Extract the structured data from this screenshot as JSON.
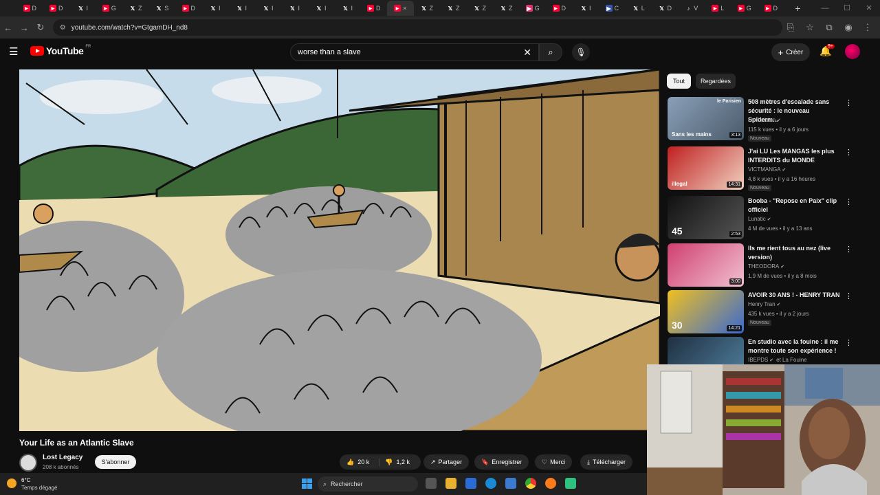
{
  "browser": {
    "tabs": [
      {
        "icon": "youtube-icon",
        "label": "D",
        "color": "#ff0033"
      },
      {
        "icon": "youtube-icon",
        "label": "D",
        "color": "#ff0033"
      },
      {
        "icon": "x-icon",
        "label": "I",
        "color": "#ffffff"
      },
      {
        "icon": "youtube-icon",
        "label": "G",
        "color": "#ff0033"
      },
      {
        "icon": "x-icon",
        "label": "Z",
        "color": "#ffffff"
      },
      {
        "icon": "x-icon",
        "label": "S",
        "color": "#ffffff"
      },
      {
        "icon": "youtube-icon",
        "label": "D",
        "color": "#ff0033"
      },
      {
        "icon": "x-icon",
        "label": "I",
        "color": "#ffffff"
      },
      {
        "icon": "x-icon",
        "label": "I",
        "color": "#ffffff"
      },
      {
        "icon": "x-icon",
        "label": "I",
        "color": "#ffffff"
      },
      {
        "icon": "x-icon",
        "label": "I",
        "color": "#ffffff"
      },
      {
        "icon": "x-icon",
        "label": "I",
        "color": "#ffffff"
      },
      {
        "icon": "x-icon",
        "label": "I",
        "color": "#ffffff"
      },
      {
        "icon": "youtube-icon",
        "label": "D",
        "color": "#ff0033"
      },
      {
        "icon": "youtube-icon",
        "label": "×",
        "color": "#ff0033",
        "active": true
      },
      {
        "icon": "x-icon",
        "label": "Z",
        "color": "#ffffff"
      },
      {
        "icon": "x-icon",
        "label": "Z",
        "color": "#ffffff"
      },
      {
        "icon": "x-icon",
        "label": "Z",
        "color": "#ffffff"
      },
      {
        "icon": "x-icon",
        "label": "Z",
        "color": "#ffffff"
      },
      {
        "icon": "instagram-icon",
        "label": "G",
        "color": "#e1306c"
      },
      {
        "icon": "youtube-icon",
        "label": "D",
        "color": "#ff0033"
      },
      {
        "icon": "x-icon",
        "label": "I",
        "color": "#ffffff"
      },
      {
        "icon": "site-icon",
        "label": "C",
        "color": "#3355aa"
      },
      {
        "icon": "x-icon",
        "label": "L",
        "color": "#ffffff"
      },
      {
        "icon": "x-icon",
        "label": "D",
        "color": "#ffffff"
      },
      {
        "icon": "tiktok-icon",
        "label": "V",
        "color": "#ffffff"
      },
      {
        "icon": "youtube-icon",
        "label": "L",
        "color": "#ff0033"
      },
      {
        "icon": "youtube-icon",
        "label": "G",
        "color": "#ff0033"
      },
      {
        "icon": "youtube-icon",
        "label": "D",
        "color": "#ff0033"
      }
    ],
    "new_tab": "+",
    "url": "youtube.com/watch?v=GtgamDH_nd8"
  },
  "header": {
    "logo_text": "YouTube",
    "logo_country": "FR",
    "search_value": "worse than a slave",
    "create_label": "Créer",
    "notif_count": "9+"
  },
  "video": {
    "title": "Your Life as an Atlantic Slave",
    "channel": "Lost Legacy",
    "subscribers": "208 k abonnés",
    "subscribe_label": "S'abonner",
    "likes": "20 k",
    "dislikes": "1,2 k",
    "share_label": "Partager",
    "save_label": "Enregistrer",
    "thanks_label": "Merci",
    "download_label": "Télécharger"
  },
  "chips": {
    "all": "Tout",
    "watched": "Regardées"
  },
  "recommendations": [
    {
      "title": "508 mètres d'escalade sans sécurité : le nouveau Spiderm...",
      "channel": "Le Parisien",
      "meta": "115 k vues • il y a 6 jours",
      "badge": "Nouveau",
      "duration": "3:13",
      "thumb_text": "Sans les mains",
      "thumb_top": "le Parisien"
    },
    {
      "title": "J'ai LU Les MANGAS les plus INTERDITS du MONDE",
      "channel": "VICTMANGA",
      "meta": "4,8 k vues • il y a 16 heures",
      "badge": "Nouveau",
      "duration": "14:31",
      "thumb_text": "illegal"
    },
    {
      "title": "Booba - \"Repose en Paix\" clip officiel",
      "channel": "Lunatic",
      "meta": "4 M de vues • il y a 13 ans",
      "badge": "",
      "duration": "2:53",
      "thumb_text": "45"
    },
    {
      "title": "Ils me rient tous au nez (live version)",
      "channel": "THEODORA",
      "meta": "1,9 M de vues • il y a 8 mois",
      "badge": "",
      "duration": "3:00",
      "thumb_text": ""
    },
    {
      "title": "AVOIR 30 ANS ! - HENRY TRAN",
      "channel": "Henry Tran",
      "meta": "435 k vues • il y a 2 jours",
      "badge": "Nouveau",
      "duration": "14:21",
      "thumb_text": "30"
    },
    {
      "title": "En studio avec la fouine : il me montre toute son expérience !",
      "channel": "IBEPDS",
      "channel2": "et La Fouine",
      "meta": "",
      "badge": "",
      "duration": "",
      "thumb_text": ""
    }
  ],
  "taskbar": {
    "temperature": "6°C",
    "weather": "Temps dégagé",
    "search_placeholder": "Rechercher"
  }
}
